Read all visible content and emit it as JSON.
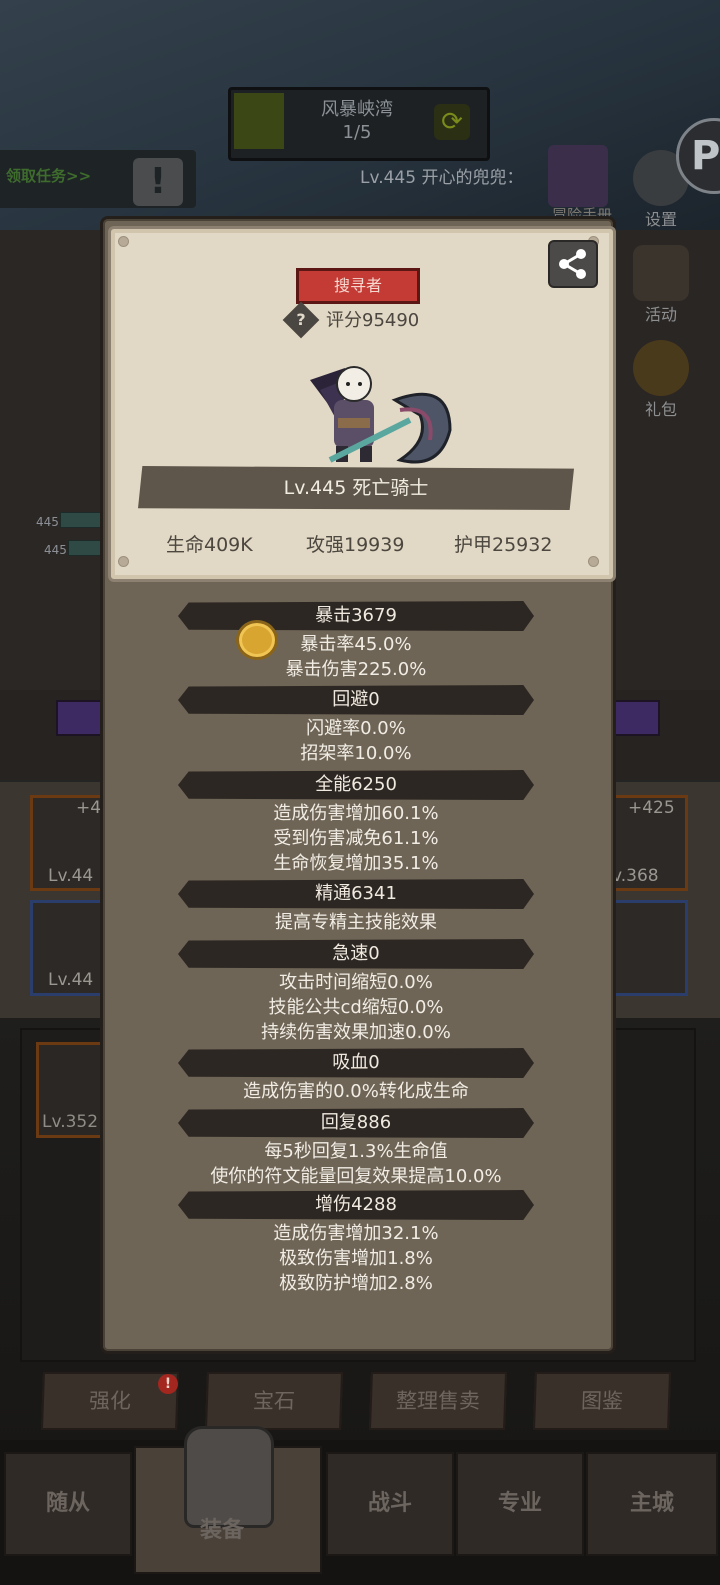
{
  "stage": {
    "name": "风暴峡湾",
    "progress": "1/5"
  },
  "task_button": "领取任务>>",
  "player_info": "Lv.445 开心的兜兜：",
  "side_buttons": {
    "settings": "设置",
    "activity": "活动",
    "gift": "礼包",
    "adventure": "冒险手册"
  },
  "party_levels": [
    "445",
    "445"
  ],
  "equipment_slots": {
    "left_top": {
      "level": "Lv.44",
      "plus": "+4"
    },
    "left_bottom": {
      "level": "Lv.44"
    },
    "right_top": {
      "level": "v.368",
      "plus": "+425"
    }
  },
  "inventory_item_level": "Lv.352",
  "actions": {
    "strengthen": "强化",
    "gem": "宝石",
    "sort_sell": "整理售卖",
    "codex": "图鉴",
    "alert": "!"
  },
  "nav_tabs": {
    "companions": "随从",
    "equip": "装备",
    "battle": "战斗",
    "profession": "专业",
    "city": "主城"
  },
  "character": {
    "class": "搜寻者",
    "score": "评分95490",
    "level_name": "Lv.445 死亡骑士",
    "base_stats": {
      "hp": "生命409K",
      "attack": "攻强19939",
      "armor": "护甲25932"
    }
  },
  "stat_sections": [
    {
      "title": "暴击3679",
      "lines": [
        "暴击率45.0%",
        "暴击伤害225.0%"
      ]
    },
    {
      "title": "回避0",
      "lines": [
        "闪避率0.0%",
        "招架率10.0%"
      ]
    },
    {
      "title": "全能6250",
      "lines": [
        "造成伤害增加60.1%",
        "受到伤害减免61.1%",
        "生命恢复增加35.1%"
      ]
    },
    {
      "title": "精通6341",
      "lines": [
        "提高专精主技能效果"
      ]
    },
    {
      "title": "急速0",
      "lines": [
        "攻击时间缩短0.0%",
        "技能公共cd缩短0.0%",
        "持续伤害效果加速0.0%"
      ]
    },
    {
      "title": "吸血0",
      "lines": [
        "造成伤害的0.0%转化成生命"
      ]
    },
    {
      "title": "回复886",
      "lines": [
        "每5秒回复1.3%生命值",
        "使你的符文能量回复效果提高10.0%"
      ]
    },
    {
      "title": "增伤4288",
      "lines": [
        "造成伤害增加32.1%",
        "极致伤害增加1.8%",
        "极致防护增加2.8%"
      ]
    }
  ]
}
